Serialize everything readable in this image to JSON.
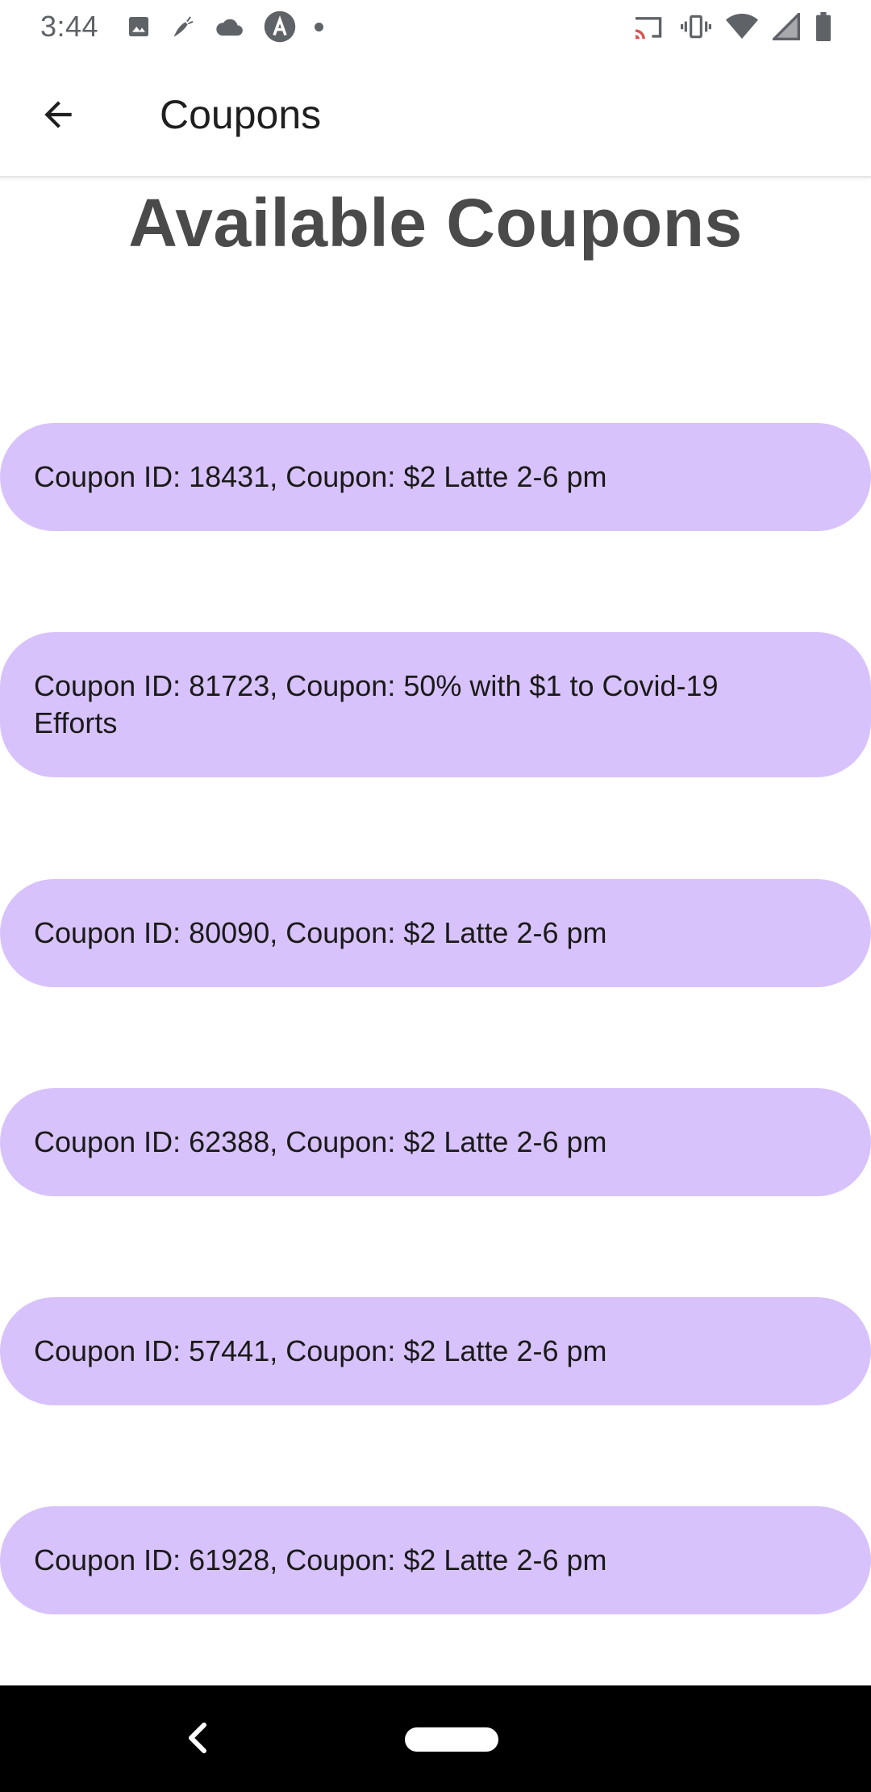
{
  "status_bar": {
    "time": "3:44",
    "left_icons": [
      "image-icon",
      "carrot-icon",
      "cloud-icon",
      "android-studio-icon",
      "notification-dot-icon"
    ],
    "right_icons": [
      "cast-icon",
      "vibrate-icon",
      "wifi-icon",
      "signal-icon",
      "battery-icon"
    ]
  },
  "app_bar": {
    "back_icon": "arrow-back-icon",
    "title": "Coupons"
  },
  "main": {
    "heading": "Available Coupons",
    "coupons": [
      {
        "text": "Coupon ID: 18431, Coupon: $2 Latte 2-6 pm"
      },
      {
        "text": "Coupon ID: 81723, Coupon: 50% with $1 to Covid-19 Efforts"
      },
      {
        "text": "Coupon ID: 80090, Coupon: $2 Latte 2-6 pm"
      },
      {
        "text": "Coupon ID: 62388, Coupon: $2 Latte 2-6 pm"
      },
      {
        "text": "Coupon ID: 57441, Coupon: $2 Latte 2-6 pm"
      },
      {
        "text": "Coupon ID: 61928, Coupon: $2 Latte 2-6 pm"
      }
    ]
  },
  "nav_bar": {
    "back_icon": "nav-back-icon",
    "home_icon": "home-pill-icon"
  },
  "colors": {
    "coupon_bg": "#d8c2fb",
    "heading": "#4a4a4a",
    "nav_bar": "#000000"
  }
}
